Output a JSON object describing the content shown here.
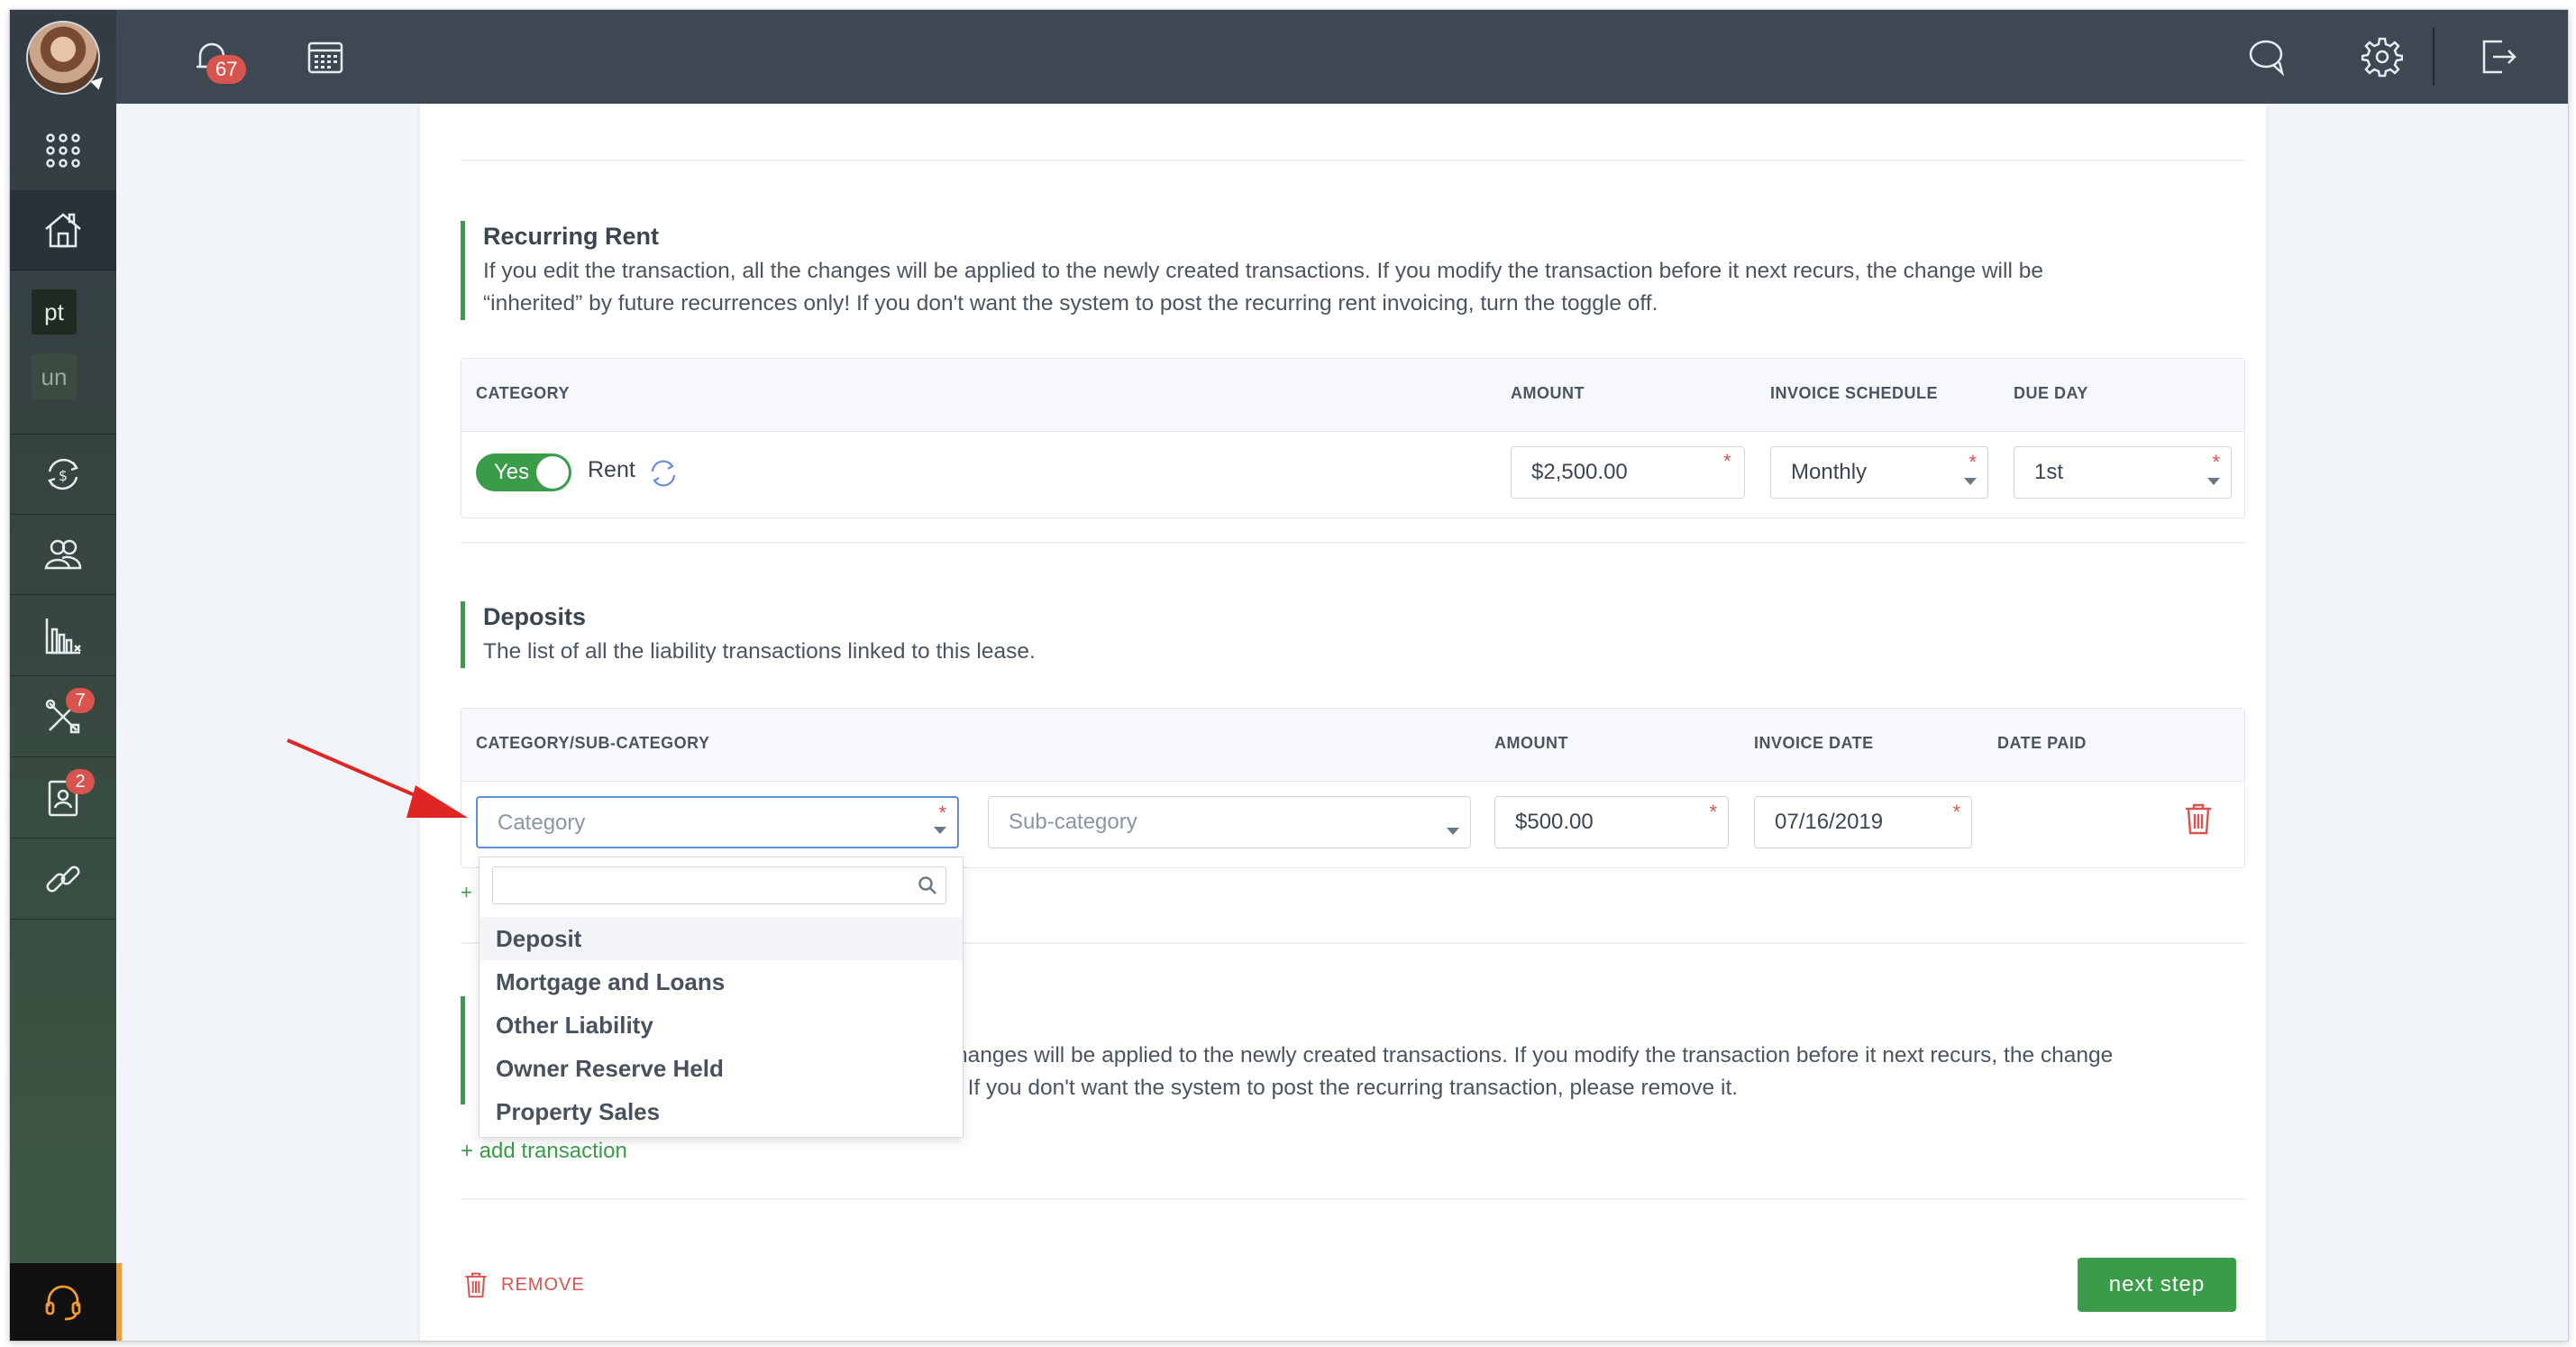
{
  "topbar": {
    "notifications_count": "67"
  },
  "sidebar": {
    "pills": {
      "pt": "pt",
      "un": "un"
    },
    "badges": {
      "tools": "7",
      "leases": "2"
    }
  },
  "recurring_rent": {
    "title": "Recurring Rent",
    "description_line1": "If you edit the transaction, all the changes will be applied to the newly created transactions. If you modify the transaction before it next recurs, the change will be",
    "description_line2": "“inherited” by future recurrences only! If you don't want the system to post the recurring rent invoicing, turn the toggle off.",
    "headers": {
      "category": "CATEGORY",
      "amount": "AMOUNT",
      "schedule": "INVOICE SCHEDULE",
      "due_day": "DUE DAY"
    },
    "toggle_label": "Yes",
    "category_label": "Rent",
    "amount": "$2,500.00",
    "schedule": "Monthly",
    "due_day": "1st"
  },
  "deposits": {
    "title": "Deposits",
    "description": "The list of all the liability transactions linked to this lease.",
    "headers": {
      "category": "CATEGORY/SUB-CATEGORY",
      "amount": "AMOUNT",
      "invoice_date": "INVOICE DATE",
      "date_paid": "DATE PAID"
    },
    "category_placeholder": "Category",
    "subcategory_placeholder": "Sub-category",
    "amount": "$500.00",
    "invoice_date": "07/16/2019",
    "add_plus": "+"
  },
  "dropdown": {
    "options": [
      "Deposit",
      "Mortgage and Loans",
      "Other Liability",
      "Owner Reserve Held",
      "Property Sales"
    ]
  },
  "recurring_tx": {
    "desc_line1": "hanges will be applied to the newly created transactions. If you modify the transaction before it next recurs, the change",
    "desc_line2": "! If you don't want the system to post the recurring transaction, please remove it.",
    "add_label": "+ add transaction"
  },
  "footer": {
    "remove_label": "REMOVE",
    "next_label": "next step"
  },
  "colors": {
    "brand_green": "#3a9b49",
    "danger": "#d9534f",
    "topbar": "#3d4852"
  }
}
